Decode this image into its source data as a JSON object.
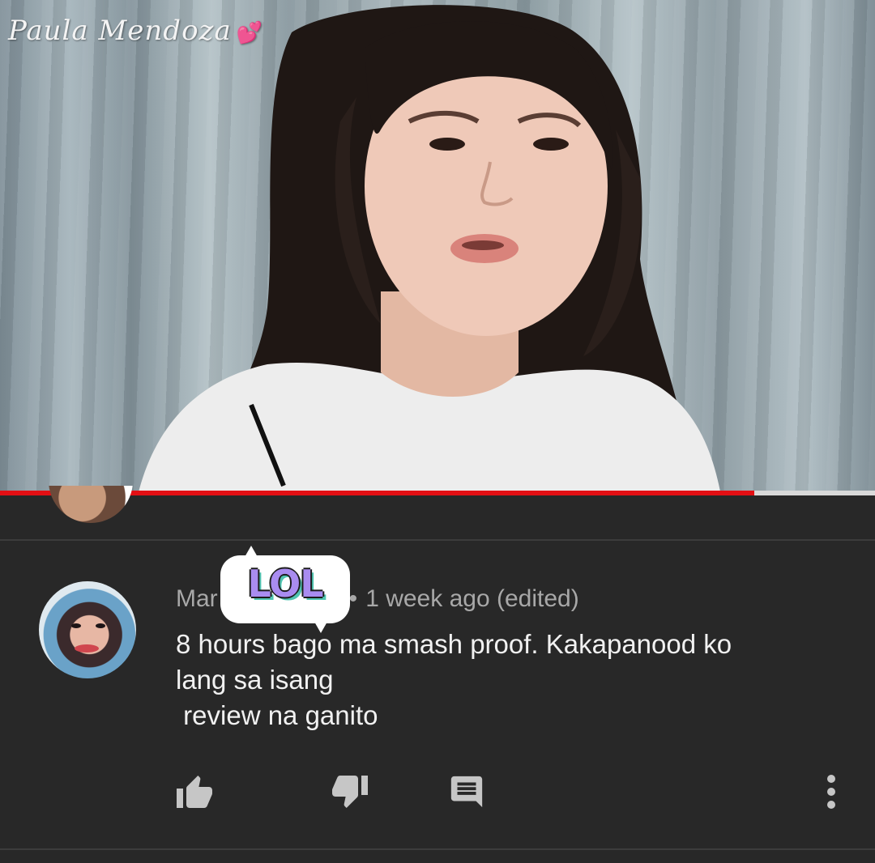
{
  "video": {
    "watermark": "Paula Mendoza",
    "watermark_icon": "pink-hearts-icon",
    "progress": 0.862,
    "progress_color": "#e30f14"
  },
  "comment": {
    "author": "Mar",
    "separator": "•",
    "timestamp": "1 week ago (edited)",
    "sticker_text": "LOL",
    "lines": [
      "8 hours bago ma smash proof. Kakapanood ko",
      "lang sa isang",
      " review na ganito"
    ],
    "actions": {
      "like_icon": "thumbs-up-icon",
      "dislike_icon": "thumbs-down-icon",
      "reply_icon": "reply-icon",
      "menu_icon": "more-vertical-icon"
    }
  },
  "colors": {
    "background": "#282828",
    "text": "#f1f1f1",
    "meta": "#a8a8a8",
    "icon": "#c6c6c6"
  }
}
